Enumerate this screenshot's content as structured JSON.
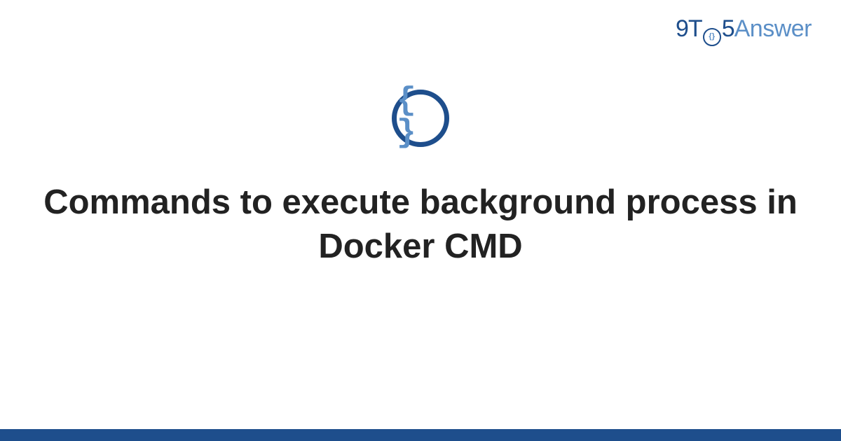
{
  "logo": {
    "part1": "9T",
    "innerBraces": "{}",
    "part2": "5",
    "part3": "Answer"
  },
  "icon": {
    "braces": "{ }"
  },
  "title": "Commands to execute background process in Docker CMD",
  "colors": {
    "dark": "#1e4e8c",
    "light": "#5b8fc7",
    "text": "#222222"
  }
}
